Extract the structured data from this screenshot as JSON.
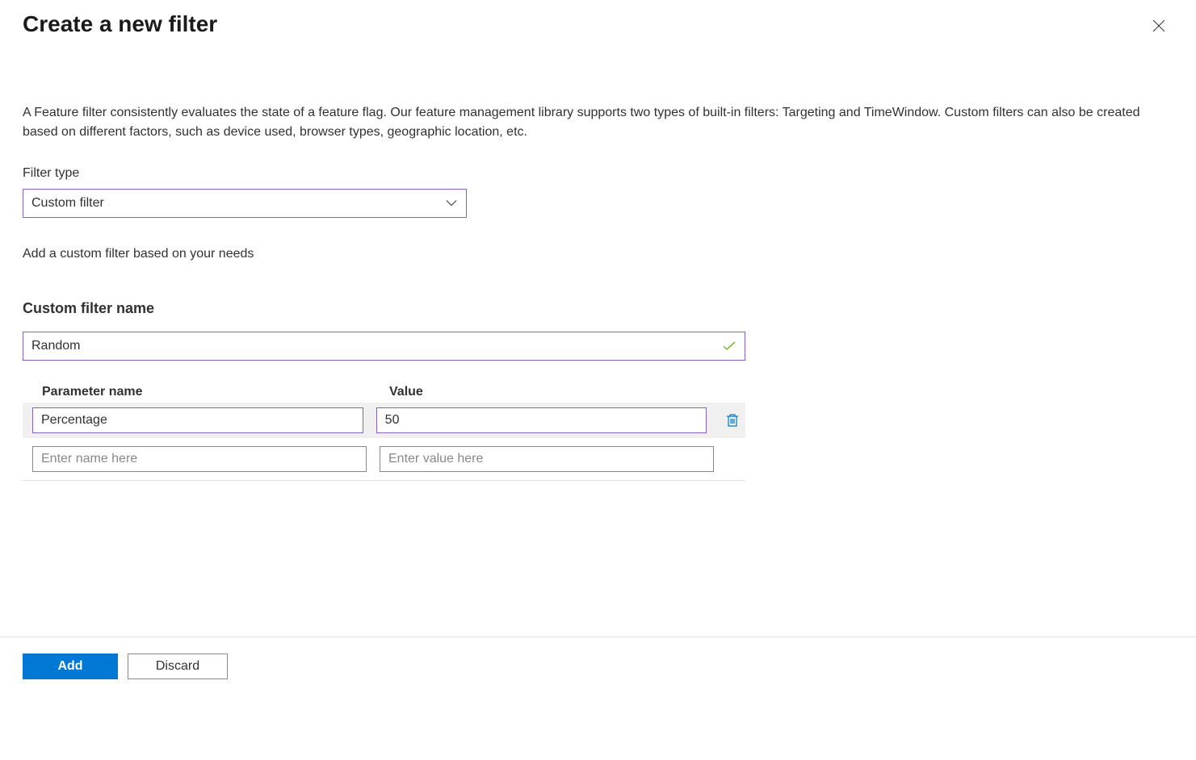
{
  "header": {
    "title": "Create a new filter"
  },
  "description": "A Feature filter consistently evaluates the state of a feature flag. Our feature management library supports two types of built-in filters: Targeting and TimeWindow. Custom filters can also be created based on different factors, such as device used, browser types, geographic location, etc.",
  "filter_type": {
    "label": "Filter type",
    "selected": "Custom filter"
  },
  "helper_text": "Add a custom filter based on your needs",
  "custom_name": {
    "label": "Custom filter name",
    "value": "Random"
  },
  "params": {
    "header_name": "Parameter name",
    "header_value": "Value",
    "rows": [
      {
        "name": "Percentage",
        "value": "50"
      }
    ],
    "placeholder_name": "Enter name here",
    "placeholder_value": "Enter value here"
  },
  "footer": {
    "add_label": "Add",
    "discard_label": "Discard"
  }
}
